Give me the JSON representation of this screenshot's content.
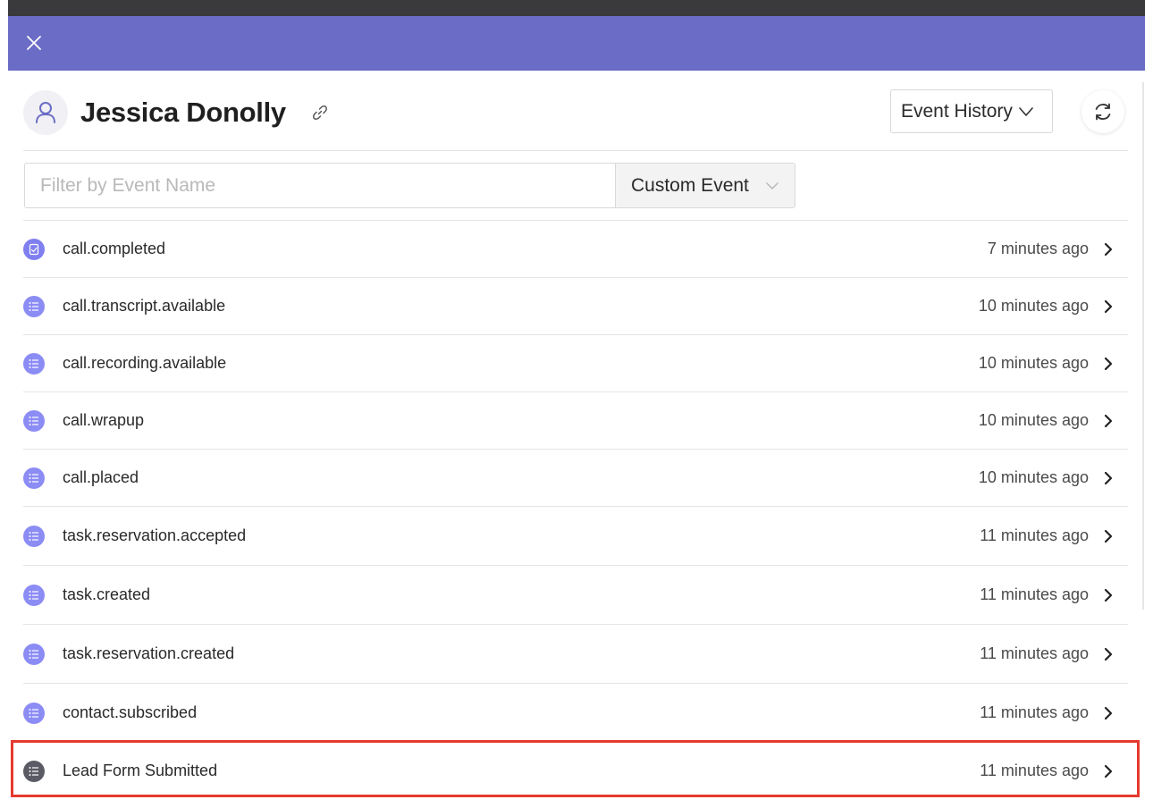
{
  "header": {
    "close_icon": "close-icon",
    "accent_color": "#6b6cc5"
  },
  "profile": {
    "name": "Jessica Donolly",
    "avatar_icon": "user-icon",
    "link_icon": "link-icon"
  },
  "view_selector": {
    "label": "Event History",
    "icon": "chevron-down-icon"
  },
  "refresh": {
    "icon": "refresh-icon"
  },
  "filter": {
    "placeholder": "Filter by Event Name",
    "value": "",
    "type_label": "Custom Event"
  },
  "events": [
    {
      "name": "call.completed",
      "time": "7 minutes ago",
      "icon": "call-completed-icon",
      "icon_color": "#7f7ff0"
    },
    {
      "name": "call.transcript.available",
      "time": "10 minutes ago",
      "icon": "list-icon",
      "icon_color": "#8c8cf5"
    },
    {
      "name": "call.recording.available",
      "time": "10 minutes ago",
      "icon": "list-icon",
      "icon_color": "#8c8cf5"
    },
    {
      "name": "call.wrapup",
      "time": "10 minutes ago",
      "icon": "list-icon",
      "icon_color": "#8c8cf5"
    },
    {
      "name": "call.placed",
      "time": "10 minutes ago",
      "icon": "list-icon",
      "icon_color": "#8c8cf5"
    },
    {
      "name": "task.reservation.accepted",
      "time": "11 minutes ago",
      "icon": "list-icon",
      "icon_color": "#8c8cf5"
    },
    {
      "name": "task.created",
      "time": "11 minutes ago",
      "icon": "list-icon",
      "icon_color": "#8c8cf5"
    },
    {
      "name": "task.reservation.created",
      "time": "11 minutes ago",
      "icon": "list-icon",
      "icon_color": "#8c8cf5"
    },
    {
      "name": "contact.subscribed",
      "time": "11 minutes ago",
      "icon": "list-icon",
      "icon_color": "#8c8cf5"
    },
    {
      "name": "Lead Form Submitted",
      "time": "11 minutes ago",
      "icon": "list-icon",
      "icon_color": "#5b5b66"
    }
  ],
  "highlight": {
    "color": "#e63a2e",
    "target": "Lead Form Submitted"
  }
}
